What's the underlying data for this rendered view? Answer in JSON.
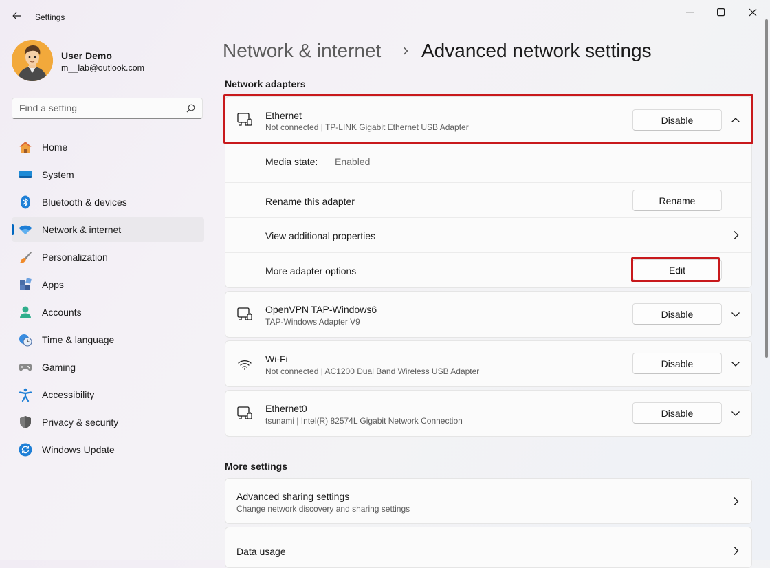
{
  "window": {
    "title": "Settings"
  },
  "user": {
    "name": "User Demo",
    "email": "m__lab@outlook.com"
  },
  "search": {
    "placeholder": "Find a setting"
  },
  "nav": [
    {
      "label": "Home",
      "icon": "home-icon"
    },
    {
      "label": "System",
      "icon": "system-icon"
    },
    {
      "label": "Bluetooth & devices",
      "icon": "bluetooth-icon"
    },
    {
      "label": "Network & internet",
      "icon": "wifi-icon",
      "active": true
    },
    {
      "label": "Personalization",
      "icon": "brush-icon"
    },
    {
      "label": "Apps",
      "icon": "apps-icon"
    },
    {
      "label": "Accounts",
      "icon": "accounts-icon"
    },
    {
      "label": "Time & language",
      "icon": "clock-globe-icon"
    },
    {
      "label": "Gaming",
      "icon": "gamepad-icon"
    },
    {
      "label": "Accessibility",
      "icon": "accessibility-icon"
    },
    {
      "label": "Privacy & security",
      "icon": "shield-icon"
    },
    {
      "label": "Windows Update",
      "icon": "update-icon"
    }
  ],
  "breadcrumb": {
    "parent": "Network & internet",
    "current": "Advanced network settings"
  },
  "adapters_section": {
    "title": "Network adapters"
  },
  "adapters": [
    {
      "name": "Ethernet",
      "detail": "Not connected | TP-LINK Gigabit Ethernet USB Adapter",
      "button": "Disable",
      "expanded": true
    },
    {
      "name": "OpenVPN TAP-Windows6",
      "detail": "TAP-Windows Adapter V9",
      "button": "Disable",
      "expanded": false
    },
    {
      "name": "Wi-Fi",
      "detail": "Not connected | AC1200  Dual Band Wireless USB Adapter",
      "button": "Disable",
      "expanded": false
    },
    {
      "name": "Ethernet0",
      "detail": "tsunami | Intel(R) 82574L Gigabit Network Connection",
      "button": "Disable",
      "expanded": false
    }
  ],
  "ethernet_details": {
    "media_state_label": "Media state:",
    "media_state_value": "Enabled",
    "rename_label": "Rename this adapter",
    "rename_button": "Rename",
    "view_props_label": "View additional properties",
    "more_options_label": "More adapter options",
    "edit_button": "Edit"
  },
  "more_settings": {
    "title": "More settings",
    "items": [
      {
        "title": "Advanced sharing settings",
        "subtitle": "Change network discovery and sharing settings"
      },
      {
        "title": "Data usage"
      }
    ]
  },
  "colors": {
    "accent": "#0067c0",
    "highlight": "#c8191c",
    "avatar_bg": "#f2a93b"
  }
}
